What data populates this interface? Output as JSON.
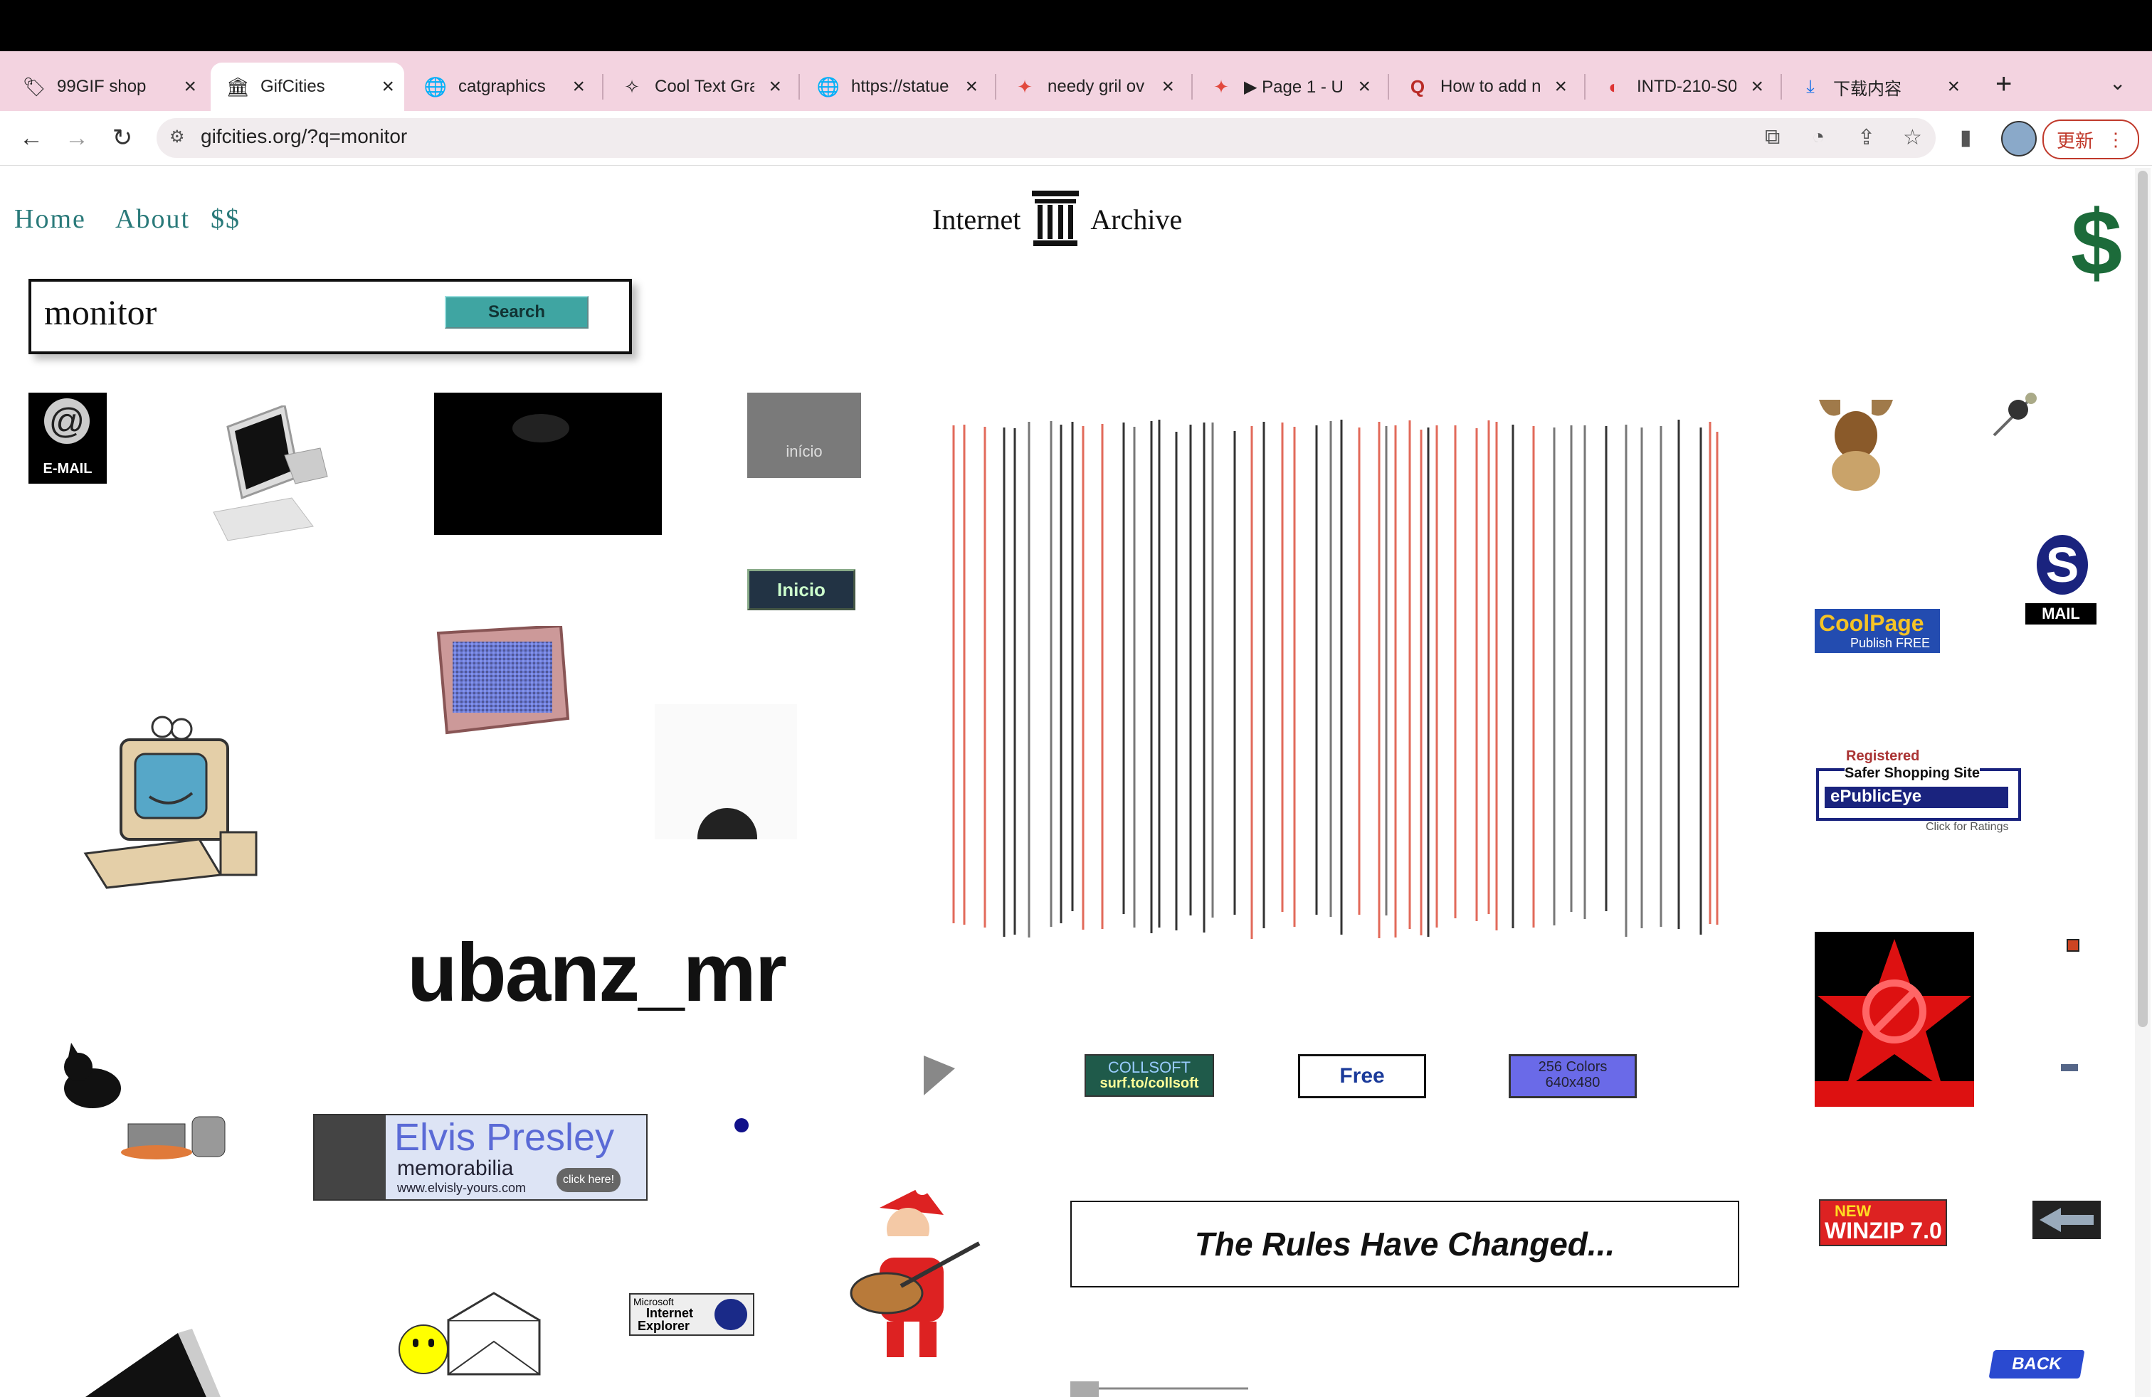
{
  "browser": {
    "tabs": [
      {
        "label": "99GIF shop",
        "icon": "price-tag-icon",
        "active": false
      },
      {
        "label": "GifCities",
        "icon": "archive-icon",
        "active": true
      },
      {
        "label": "catgraphics",
        "icon": "globe-icon",
        "active": false
      },
      {
        "label": "Cool Text Gra",
        "icon": "cool-text-icon",
        "active": false
      },
      {
        "label": "https://statue",
        "icon": "globe-icon",
        "active": false
      },
      {
        "label": "needy gril ov",
        "icon": "figma-icon",
        "active": false
      },
      {
        "label": "▶ Page 1 - U",
        "icon": "figma-icon",
        "active": false
      },
      {
        "label": "How to add n",
        "icon": "quora-icon",
        "active": false
      },
      {
        "label": "INTD-210-S0",
        "icon": "loading-icon",
        "active": false
      },
      {
        "label": "下载内容",
        "icon": "download-icon",
        "active": false
      }
    ],
    "url": "gifcities.org/?q=monitor",
    "update_label": "更新"
  },
  "page": {
    "nav": {
      "home": "Home",
      "about": "About",
      "donate": "$$"
    },
    "logo": {
      "left": "Internet",
      "right": "Archive"
    },
    "search": {
      "query": "monitor",
      "button": "Search"
    }
  },
  "gifs": {
    "email_label": "E-MAIL",
    "inicio_gray": "início",
    "inicio_button": "Inicio",
    "ubanz_text": "ubanz_mr",
    "elvis_title": "Elvis Presley",
    "elvis_sub": "memorabilia",
    "elvis_url": "www.elvisly-yours.com",
    "elvis_click": "click here!",
    "ie_line1": "Microsoft",
    "ie_line2": "Internet",
    "ie_line3": "Explorer",
    "collsoft_line1": "COLLSOFT",
    "collsoft_line2": "surf.to/collsoft",
    "free_label": "Free",
    "colors_line1": "256 Colors",
    "colors_line2": "640x480",
    "rules_text": "The Rules Have Changed...",
    "coolpage_line1": "CoolPage",
    "coolpage_line2": "Publish FREE",
    "mail_label": "MAIL",
    "epublic_line1": "Registered",
    "epublic_line2": "Safer Shopping Site",
    "epublic_line3": "ePublicEye",
    "epublic_line4": "Click for Ratings",
    "winzip_line1": "NEW",
    "winzip_line2": "WINZIP 7.0",
    "back_label": "BACK"
  }
}
